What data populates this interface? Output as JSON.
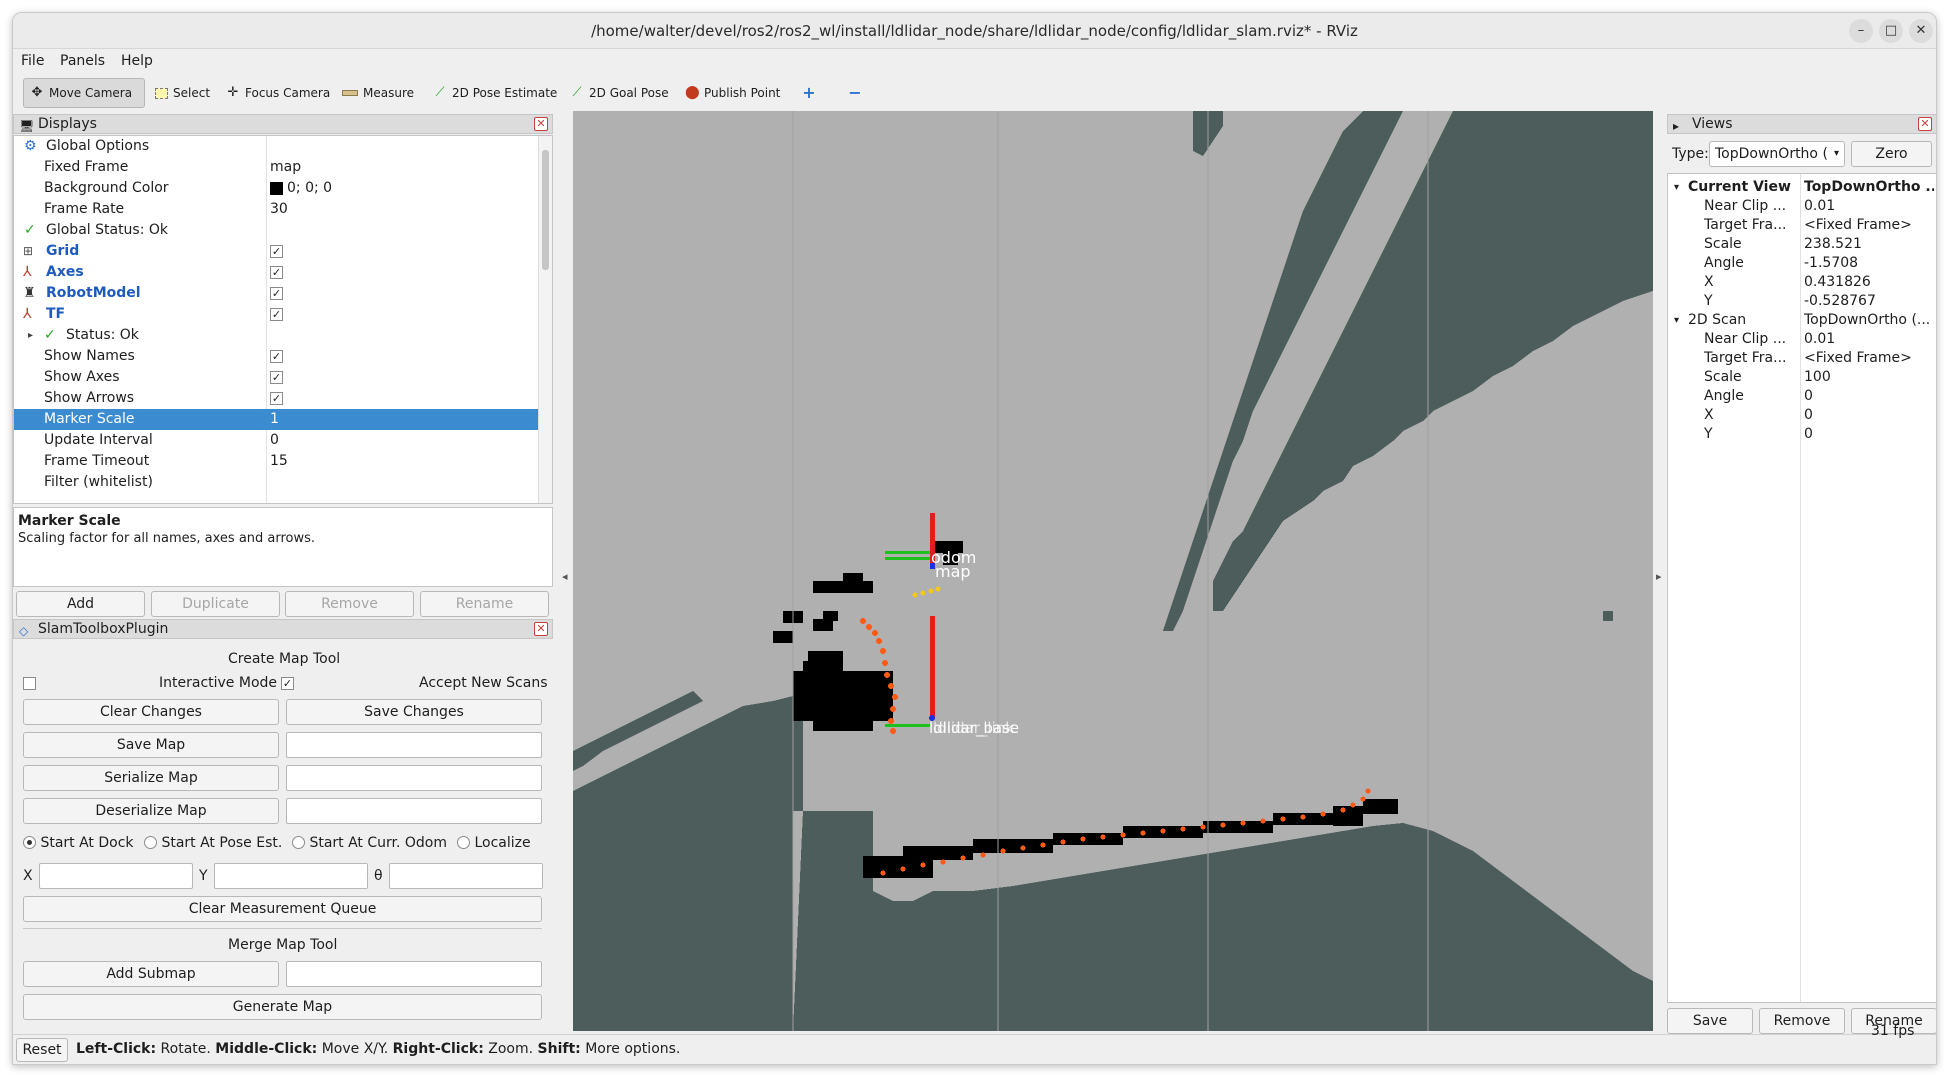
{
  "window": {
    "title": "/home/walter/devel/ros2/ros2_wl/install/ldlidar_node/share/ldlidar_node/config/ldlidar_slam.rviz* - RViz",
    "minimize": "–",
    "maximize": "□",
    "close": "✕"
  },
  "menu": {
    "file": "File",
    "panels": "Panels",
    "help": "Help"
  },
  "toolbar": {
    "move_camera": "Move Camera",
    "select": "Select",
    "focus_camera": "Focus Camera",
    "measure": "Measure",
    "pose_estimate": "2D Pose Estimate",
    "goal_pose": "2D Goal Pose",
    "publish_point": "Publish Point"
  },
  "displays": {
    "title": "Displays",
    "rows": [
      {
        "key": "Global Options",
        "val": ""
      },
      {
        "key": "Fixed Frame",
        "val": "map"
      },
      {
        "key": "Background Color",
        "val": "0; 0; 0"
      },
      {
        "key": "Frame Rate",
        "val": "30"
      },
      {
        "key": "Global Status: Ok",
        "val": ""
      },
      {
        "key": "Grid",
        "val": ""
      },
      {
        "key": "Axes",
        "val": ""
      },
      {
        "key": "RobotModel",
        "val": ""
      },
      {
        "key": "TF",
        "val": ""
      },
      {
        "key": "Status: Ok",
        "val": ""
      },
      {
        "key": "Show Names",
        "val": ""
      },
      {
        "key": "Show Axes",
        "val": ""
      },
      {
        "key": "Show Arrows",
        "val": ""
      },
      {
        "key": "Marker Scale",
        "val": "1"
      },
      {
        "key": "Update Interval",
        "val": "0"
      },
      {
        "key": "Frame Timeout",
        "val": "15"
      },
      {
        "key": "Filter (whitelist)",
        "val": ""
      }
    ],
    "desc_title": "Marker Scale",
    "desc_text": "Scaling factor for all names, axes and arrows.",
    "buttons": {
      "add": "Add",
      "duplicate": "Duplicate",
      "remove": "Remove",
      "rename": "Rename"
    }
  },
  "slam": {
    "title": "SlamToolboxPlugin",
    "create_map_tool": "Create Map Tool",
    "interactive_mode": "Interactive Mode",
    "accept_new_scans": "Accept New Scans",
    "clear_changes": "Clear Changes",
    "save_changes": "Save Changes",
    "save_map": "Save Map",
    "serialize_map": "Serialize Map",
    "deserialize_map": "Deserialize Map",
    "start_at_dock": "Start At Dock",
    "start_at_pose_est": "Start At Pose Est.",
    "start_at_curr_odom": "Start At Curr. Odom",
    "localize": "Localize",
    "x_label": "X",
    "y_label": "Y",
    "theta_label": "θ",
    "clear_measurement_queue": "Clear Measurement Queue",
    "merge_map_tool": "Merge Map Tool",
    "add_submap": "Add Submap",
    "generate_map": "Generate Map"
  },
  "viewport": {
    "label_odom": "odom",
    "label_map": "map",
    "label_laser": "ldlidar_base",
    "label_laser2": "ldlidar_link"
  },
  "views": {
    "title": "Views",
    "type_label": "Type:",
    "type_value": "TopDownOrtho (",
    "zero": "Zero",
    "rows": [
      {
        "key": "Current View",
        "val": "TopDownOrtho ...",
        "bold": true,
        "level": 0
      },
      {
        "key": "Near Clip ...",
        "val": "0.01",
        "level": 1
      },
      {
        "key": "Target Fra...",
        "val": "<Fixed Frame>",
        "level": 1
      },
      {
        "key": "Scale",
        "val": "238.521",
        "level": 1
      },
      {
        "key": "Angle",
        "val": "-1.5708",
        "level": 1
      },
      {
        "key": "X",
        "val": "0.431826",
        "level": 1
      },
      {
        "key": "Y",
        "val": "-0.528767",
        "level": 1
      },
      {
        "key": "2D Scan",
        "val": "TopDownOrtho (...",
        "level": 0
      },
      {
        "key": "Near Clip ...",
        "val": "0.01",
        "level": 1
      },
      {
        "key": "Target Fra...",
        "val": "<Fixed Frame>",
        "level": 1
      },
      {
        "key": "Scale",
        "val": "100",
        "level": 1
      },
      {
        "key": "Angle",
        "val": "0",
        "level": 1
      },
      {
        "key": "X",
        "val": "0",
        "level": 1
      },
      {
        "key": "Y",
        "val": "0",
        "level": 1
      }
    ],
    "save": "Save",
    "remove": "Remove",
    "rename": "Rename"
  },
  "status": {
    "reset": "Reset",
    "left_click": "Left-Click:",
    "rotate": "Rotate.",
    "middle_click": "Middle-Click:",
    "move": "Move X/Y.",
    "right_click": "Right-Click:",
    "zoom": "Zoom.",
    "shift": "Shift:",
    "more": "More options.",
    "fps": "31 fps"
  },
  "colors": {
    "selection": "#3b8bd0",
    "map_free": "#b0b0b0",
    "map_unknown": "#4d5d5b",
    "map_occupied": "#000000",
    "scan": "#ff5a14"
  }
}
